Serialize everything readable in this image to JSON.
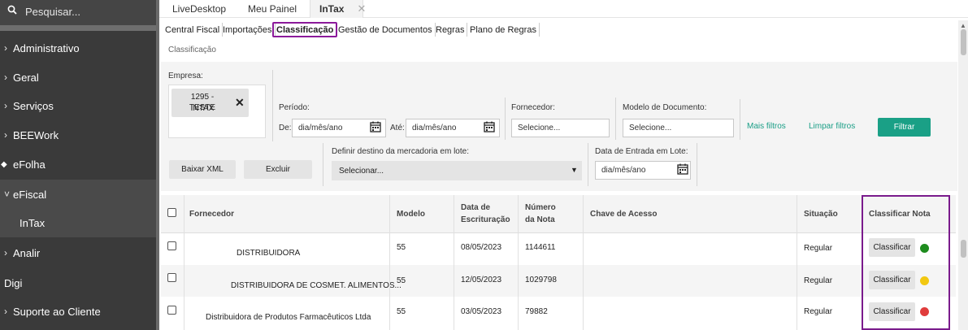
{
  "sidebar": {
    "search_placeholder": "Pesquisar...",
    "items": [
      {
        "label": "Administrativo",
        "chevron": "›"
      },
      {
        "label": "Geral",
        "chevron": "›"
      },
      {
        "label": "Serviços",
        "chevron": "›"
      },
      {
        "label": "BEEWork",
        "chevron": "›"
      },
      {
        "label": "eFolha",
        "chevron": ""
      },
      {
        "label": "eFiscal",
        "chevron": "˅"
      },
      {
        "label": "InTax",
        "chevron": ""
      },
      {
        "label": "Analir",
        "chevron": "›"
      },
      {
        "label": "Digi",
        "chevron": ""
      },
      {
        "label": "Suporte ao Cliente",
        "chevron": "›"
      }
    ]
  },
  "tabs": [
    {
      "label": "LiveDesktop"
    },
    {
      "label": "Meu Painel"
    },
    {
      "label": "InTax",
      "close": "✕"
    }
  ],
  "modules": [
    {
      "label": "Central Fiscal"
    },
    {
      "label": "Importações"
    },
    {
      "label": "Classificação"
    },
    {
      "label": "Gestão de Documentos"
    },
    {
      "label": "Regras"
    },
    {
      "label": "Plano de Regras"
    }
  ],
  "breadcrumb": "Classificação",
  "filters": {
    "empresa_label": "Empresa:",
    "empresa_chip_line1": "1295 - TESTE",
    "empresa_chip_line2": "INTAX",
    "periodo_label": "Período:",
    "de_label": "De:",
    "ate_label": "Até:",
    "date_placeholder": "dia/mês/ano",
    "fornecedor_label": "Fornecedor:",
    "fornecedor_placeholder": "Selecione...",
    "modelo_label": "Modelo de Documento:",
    "modelo_placeholder": "Selecione...",
    "mais_filtros": "Mais filtros",
    "limpar_filtros": "Limpar filtros",
    "filtrar": "Filtrar",
    "baixar_xml": "Baixar XML",
    "excluir": "Excluir",
    "destino_label": "Definir destino da mercadoria em lote:",
    "destino_value": "Selecionar...",
    "data_entrada_label": "Data de Entrada em Lote:",
    "data_entrada_placeholder": "dia/mês/ano"
  },
  "table": {
    "headers": {
      "fornecedor": "Fornecedor",
      "modelo": "Modelo",
      "data_l1": "Data de",
      "data_l2": "Escrituração",
      "numero_l1": "Número",
      "numero_l2": "da Nota",
      "chave": "Chave de Acesso",
      "situacao": "Situação",
      "classificar": "Classificar Nota"
    },
    "rows": [
      {
        "fornecedor": "DISTRIBUIDORA",
        "modelo": "55",
        "data": "08/05/2023",
        "numero": "1144611",
        "chave": "",
        "situacao": "Regular",
        "action": "Classificar",
        "status_color": "#1e8c1e"
      },
      {
        "fornecedor": "DISTRIBUIDORA DE COSMET. ALIMENTOS...",
        "modelo": "55",
        "data": "12/05/2023",
        "numero": "1029798",
        "chave": "",
        "situacao": "Regular",
        "action": "Classificar",
        "status_color": "#f2c811"
      },
      {
        "fornecedor": "Distribuidora de Produtos Farmacêuticos Ltda",
        "modelo": "55",
        "data": "03/05/2023",
        "numero": "79882",
        "chave": "",
        "situacao": "Regular",
        "action": "Classificar",
        "status_color": "#e03c3c"
      }
    ]
  },
  "colors": {
    "accent": "#1aa086",
    "highlight": "#7a1b8c",
    "sidebar_bg": "#3a3a3a"
  }
}
